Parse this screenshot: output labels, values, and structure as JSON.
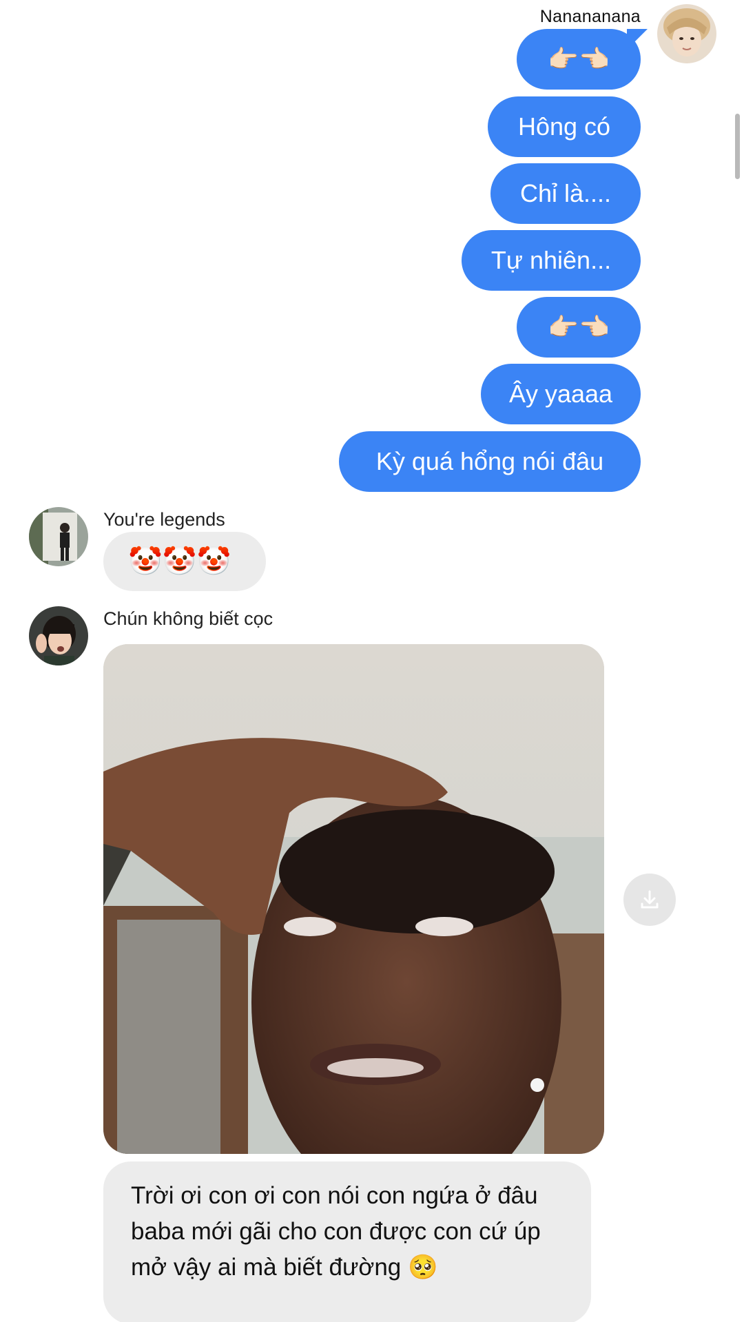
{
  "outgoing": {
    "sender_name": "Nanananana",
    "messages": [
      {
        "text": "👉🏻👈🏻"
      },
      {
        "text": "Hông có"
      },
      {
        "text": "Chỉ là...."
      },
      {
        "text": "Tự nhiên..."
      },
      {
        "text": "👉🏻👈🏻"
      },
      {
        "text": "Ây yaaaa"
      },
      {
        "text": "Kỳ quá hổng nói đâu"
      }
    ],
    "bubble_color": "#3b84f5"
  },
  "incoming": [
    {
      "sender_name": "You're legends",
      "message": "🤡🤡🤡"
    },
    {
      "sender_name": "Chún không biết cọc",
      "attachment": "meme-photo",
      "message": "Trời ơi con ơi con nói con ngứa ở đâu baba mới gãi  cho con được con cứ úp mở vậy ai mà biết đường 🥺"
    }
  ],
  "icons": {
    "download": "download-icon"
  }
}
